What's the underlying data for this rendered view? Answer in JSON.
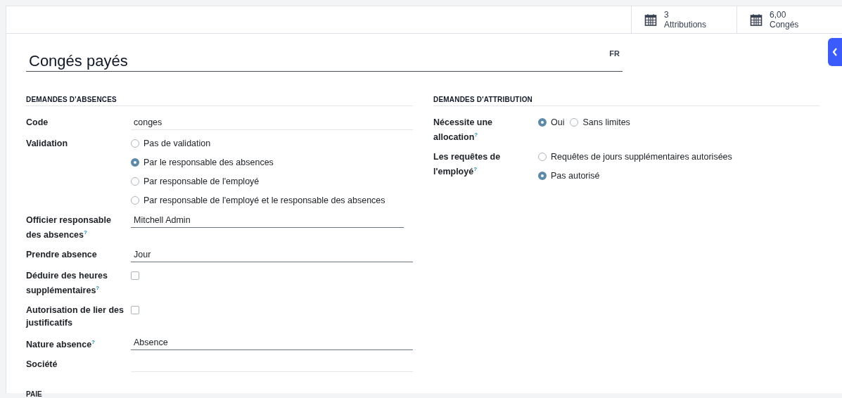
{
  "stat_buttons": [
    {
      "value": "3",
      "label": "Attributions"
    },
    {
      "value": "6,00",
      "label": "Congés"
    }
  ],
  "title": "Congés payés",
  "language": "FR",
  "left_section": {
    "title": "DEMANDES D'ABSENCES",
    "fields": [
      {
        "kind": "text",
        "label": "Code",
        "value": "conges"
      },
      {
        "kind": "radio",
        "label": "Validation",
        "options": [
          {
            "label": "Pas de validation",
            "selected": false
          },
          {
            "label": "Par le responsable des absences",
            "selected": true
          },
          {
            "label": "Par responsable de l'employé",
            "selected": false
          },
          {
            "label": "Par responsable de l'employé et le responsable des absences",
            "selected": false
          }
        ]
      },
      {
        "kind": "many2one",
        "label": "Officier responsable des absences$^{?}$",
        "value": "Mitchell Admin"
      },
      {
        "kind": "selection",
        "label": "Prendre absence",
        "value": "Jour"
      },
      {
        "kind": "checkbox",
        "label": "Déduire des heures supplémentaires$^{?}$",
        "checked": false
      },
      {
        "kind": "checkbox",
        "label": "Autorisation de lier des justificatifs",
        "checked": false
      },
      {
        "kind": "selection",
        "label": "Nature absence$^{?}$",
        "value": "Absence"
      },
      {
        "kind": "text",
        "label": "Société"
      }
    ]
  },
  "right_section": {
    "title": "DEMANDES D'ATTRIBUTION",
    "fields": [
      {
        "kind": "radio_inline",
        "label": "Nécessite une allocation$^{?}$",
        "options": [
          {
            "label": "Oui",
            "selected": true
          },
          {
            "label": "Sans limites",
            "selected": false
          }
        ]
      },
      {
        "kind": "radio",
        "label": "Les requêtes de l'employé$^{?}$",
        "options": [
          {
            "label": "Requêtes de jours supplémentaires autorisées",
            "selected": false
          },
          {
            "label": "Pas autorisé",
            "selected": true
          }
        ]
      }
    ]
  },
  "next_section": {
    "title": "PAIE"
  }
}
